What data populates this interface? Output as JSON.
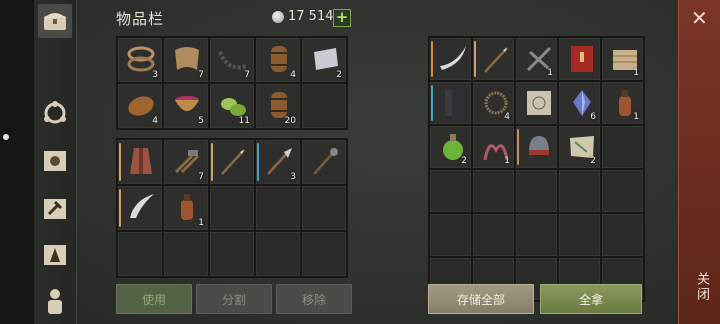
{
  "header": {
    "title": "物品栏",
    "currency_amount": "17 514",
    "add_label": "+"
  },
  "sidebar": {
    "tabs": [
      {
        "name": "chest-icon"
      },
      {
        "name": "crafting-gear-icon"
      },
      {
        "name": "sun-map-icon"
      },
      {
        "name": "hammer-map-icon"
      },
      {
        "name": "wizard-hat-icon"
      },
      {
        "name": "character-icon"
      }
    ]
  },
  "inventory_top": [
    {
      "item": "rope-icon",
      "qty": "3"
    },
    {
      "item": "cloth-icon",
      "qty": "7"
    },
    {
      "item": "chain-icon",
      "qty": "7"
    },
    {
      "item": "barrel-icon",
      "qty": "4"
    },
    {
      "item": "scroll-paper-icon",
      "qty": "2"
    },
    {
      "item": "bread-icon",
      "qty": "4"
    },
    {
      "item": "berry-bowl-icon",
      "qty": "5"
    },
    {
      "item": "cucumber-icon",
      "qty": "11"
    },
    {
      "item": "barrel-icon",
      "qty": "20"
    },
    {
      "item": "",
      "qty": ""
    }
  ],
  "inventory_bottom": [
    {
      "item": "robe-icon",
      "qty": "",
      "bar": "#c9a36a"
    },
    {
      "item": "hammers-icon",
      "qty": "7",
      "bar": ""
    },
    {
      "item": "spear-icon",
      "qty": "",
      "bar": "#c9a36a"
    },
    {
      "item": "halberd-icon",
      "qty": "3",
      "bar": "#4aa0c8"
    },
    {
      "item": "mace-staff-icon",
      "qty": "",
      "bar": ""
    },
    {
      "item": "scimitar-icon",
      "qty": "",
      "bar": "#c9a36a"
    },
    {
      "item": "leather-flask-icon",
      "qty": "1",
      "bar": ""
    },
    {
      "item": "",
      "qty": "",
      "bar": ""
    },
    {
      "item": "",
      "qty": "",
      "bar": ""
    },
    {
      "item": "",
      "qty": "",
      "bar": ""
    },
    {
      "item": "",
      "qty": "",
      "bar": ""
    },
    {
      "item": "",
      "qty": "",
      "bar": ""
    },
    {
      "item": "",
      "qty": "",
      "bar": ""
    },
    {
      "item": "",
      "qty": "",
      "bar": ""
    },
    {
      "item": "",
      "qty": "",
      "bar": ""
    }
  ],
  "storage": [
    {
      "item": "curved-blade-icon",
      "qty": "",
      "bar": "#d08a3a"
    },
    {
      "item": "spear-icon",
      "qty": "",
      "bar": "#c9a36a"
    },
    {
      "item": "crossbow-icon",
      "qty": "1",
      "bar": ""
    },
    {
      "item": "red-book-icon",
      "qty": "",
      "bar": ""
    },
    {
      "item": "planks-icon",
      "qty": "1",
      "bar": ""
    },
    {
      "item": "leg-armor-icon",
      "qty": "",
      "bar": "#4aa0c8"
    },
    {
      "item": "thorn-crown-icon",
      "qty": "4",
      "bar": ""
    },
    {
      "item": "blueprint-icon",
      "qty": "",
      "bar": ""
    },
    {
      "item": "crystal-icon",
      "qty": "6",
      "bar": ""
    },
    {
      "item": "leather-flask-icon",
      "qty": "1",
      "bar": ""
    },
    {
      "item": "green-potion-icon",
      "qty": "2",
      "bar": ""
    },
    {
      "item": "tentacle-icon",
      "qty": "1",
      "bar": ""
    },
    {
      "item": "helmet-icon",
      "qty": "",
      "bar": "#d08a3a"
    },
    {
      "item": "map-icon",
      "qty": "2",
      "bar": ""
    },
    {
      "item": "",
      "qty": "",
      "bar": ""
    }
  ],
  "buttons": {
    "use": "使用",
    "split": "分割",
    "remove": "移除",
    "store_all": "存储全部",
    "take_all": "全拿"
  },
  "close_panel": {
    "label": "关闭",
    "icon": "close-icon"
  },
  "colors": {
    "accent_green": "#7ea34a",
    "close_red": "#7a3526",
    "rarity_orange": "#d08a3a",
    "rarity_blue": "#4aa0c8",
    "rarity_tan": "#c9a36a"
  }
}
